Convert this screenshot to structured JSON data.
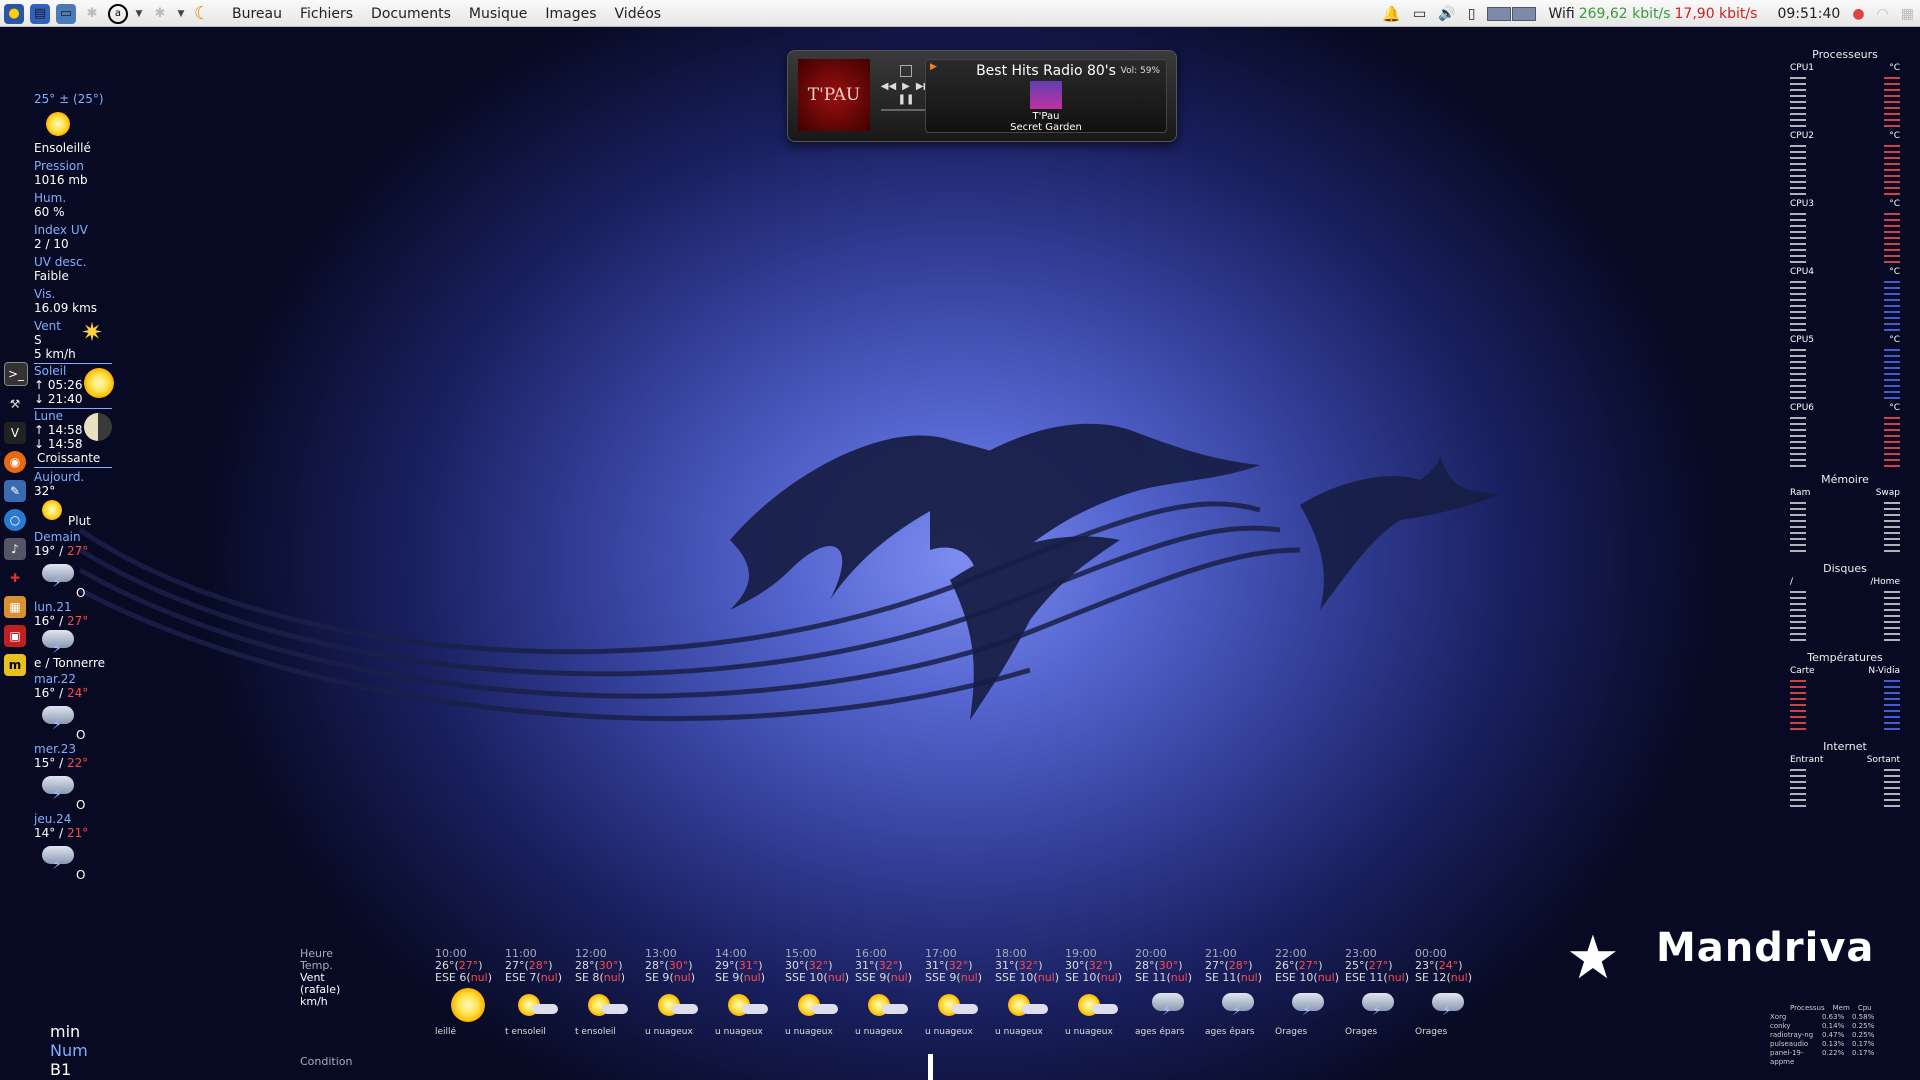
{
  "topbar": {
    "menu": [
      "Bureau",
      "Fichiers",
      "Documents",
      "Musique",
      "Images",
      "Vidéos"
    ],
    "wifi_label": "Wifi",
    "down": "269,62 kbit/s",
    "up": "17,90 kbit/s",
    "clock": "09:51:40"
  },
  "weather": {
    "current_temp": "25° ± (25°)",
    "condition": "Ensoleillé",
    "pressure_label": "Pression",
    "pressure": "1016 mb",
    "hum_label": "Hum.",
    "hum": "60 %",
    "uv_label": "Index UV",
    "uv": "2 / 10",
    "uvdesc_label": "UV desc.",
    "uvdesc": "Faible",
    "vis_label": "Vis.",
    "vis": "16.09 kms",
    "wind_label": "Vent",
    "wind_dir": "S",
    "wind_speed": "5 km/h",
    "sun_label": "Soleil",
    "sunrise": "↑ 05:26",
    "sunset": "↓ 21:40",
    "moon_label": "Lune",
    "moonrise": "↑ 14:58",
    "moonset": "↓ 14:58",
    "moon_phase": "Croissante",
    "today_label": "Aujourd.",
    "today_temp": "32°",
    "today_cond": "Plut",
    "days": [
      {
        "name": "Demain",
        "min": "19°",
        "max": "27°",
        "cond": "O"
      },
      {
        "name": "lun.21",
        "min": "16°",
        "max": "27°",
        "cond": "e / Tonnerre"
      },
      {
        "name": "mar.22",
        "min": "16°",
        "max": "24°",
        "cond": "O"
      },
      {
        "name": "mer.23",
        "min": "15°",
        "max": "22°",
        "cond": "O"
      },
      {
        "name": "jeu.24",
        "min": "14°",
        "max": "21°",
        "cond": "O"
      }
    ]
  },
  "player": {
    "cover_text": "T'PAU",
    "station": "Best Hits Radio 80's",
    "volume": "Vol: 59%",
    "artist": "T'Pau",
    "track": "Secret Garden"
  },
  "sysmon": {
    "processors_title": "Processeurs",
    "cpus": [
      {
        "name": "CPU1",
        "unit": "°C"
      },
      {
        "name": "CPU2",
        "unit": "°C"
      },
      {
        "name": "CPU3",
        "unit": "°C"
      },
      {
        "name": "CPU4",
        "unit": "°C"
      },
      {
        "name": "CPU5",
        "unit": "°C"
      },
      {
        "name": "CPU6",
        "unit": "°C"
      }
    ],
    "memory_title": "Mémoire",
    "ram": "Ram",
    "swap": "Swap",
    "disks_title": "Disques",
    "disk_root": "/",
    "disk_home": "/Home",
    "temps_title": "Températures",
    "temp_card": "Carte",
    "temp_nvidia": "N-Vidia",
    "internet_title": "Internet",
    "net_in": "Entrant",
    "net_out": "Sortant",
    "proc_header": [
      "Processus",
      "Mem",
      "Cpu"
    ],
    "processes": [
      [
        "Xorg",
        "0.63%",
        "0.58%"
      ],
      [
        "conky",
        "0.14%",
        "0.25%"
      ],
      [
        "radiotray-ng",
        "0.47%",
        "0.25%"
      ],
      [
        "pulseaudio",
        "0.13%",
        "0.17%"
      ],
      [
        "panel-19-appme",
        "0.22%",
        "0.17%"
      ]
    ]
  },
  "hourly": {
    "label_hour": "Heure",
    "label_temp": "Temp.",
    "label_wind": "Vent (rafale) km/h",
    "label_cond": "Condition",
    "hours": [
      {
        "h": "10:00",
        "t": "26°",
        "tf": "27°",
        "w": "ESE 6",
        "c": "leillé",
        "icon": "sun"
      },
      {
        "h": "11:00",
        "t": "27°",
        "tf": "28°",
        "w": "ESE 7",
        "c": "t ensoleil",
        "icon": "sun-cloud"
      },
      {
        "h": "12:00",
        "t": "28°",
        "tf": "30°",
        "w": "SE 8",
        "c": "t ensoleil",
        "icon": "sun-cloud"
      },
      {
        "h": "13:00",
        "t": "28°",
        "tf": "30°",
        "w": "SE 9",
        "c": "u nuageux",
        "icon": "sun-cloud"
      },
      {
        "h": "14:00",
        "t": "29°",
        "tf": "31°",
        "w": "SE 9",
        "c": "u nuageux",
        "icon": "sun-cloud"
      },
      {
        "h": "15:00",
        "t": "30°",
        "tf": "32°",
        "w": "SSE 10",
        "c": "u nuageux",
        "icon": "sun-cloud"
      },
      {
        "h": "16:00",
        "t": "31°",
        "tf": "32°",
        "w": "SSE 9",
        "c": "u nuageux",
        "icon": "sun-cloud"
      },
      {
        "h": "17:00",
        "t": "31°",
        "tf": "32°",
        "w": "SSE 9",
        "c": "u nuageux",
        "icon": "sun-cloud"
      },
      {
        "h": "18:00",
        "t": "31°",
        "tf": "32°",
        "w": "SSE 10",
        "c": "u nuageux",
        "icon": "sun-cloud"
      },
      {
        "h": "19:00",
        "t": "30°",
        "tf": "32°",
        "w": "SE 10",
        "c": "u nuageux",
        "icon": "sun-cloud"
      },
      {
        "h": "20:00",
        "t": "28°",
        "tf": "30°",
        "w": "SE 11",
        "c": "ages épars",
        "icon": "storm"
      },
      {
        "h": "21:00",
        "t": "27°",
        "tf": "28°",
        "w": "SE 11",
        "c": "ages épars",
        "icon": "storm"
      },
      {
        "h": "22:00",
        "t": "26°",
        "tf": "27°",
        "w": "ESE 10",
        "c": "Orages",
        "icon": "storm"
      },
      {
        "h": "23:00",
        "t": "25°",
        "tf": "27°",
        "w": "ESE 11",
        "c": "Orages",
        "icon": "storm"
      },
      {
        "h": "00:00",
        "t": "23°",
        "tf": "24°",
        "w": "SE 12",
        "c": "Orages",
        "icon": "storm"
      }
    ]
  },
  "branding": {
    "logo": "Mandriva"
  },
  "keyboard": {
    "min": "min",
    "num": "Num",
    "layout": "B1"
  },
  "colors": {
    "accent_blue": "#7fb0ff",
    "alert_red": "#ff4a4a"
  }
}
